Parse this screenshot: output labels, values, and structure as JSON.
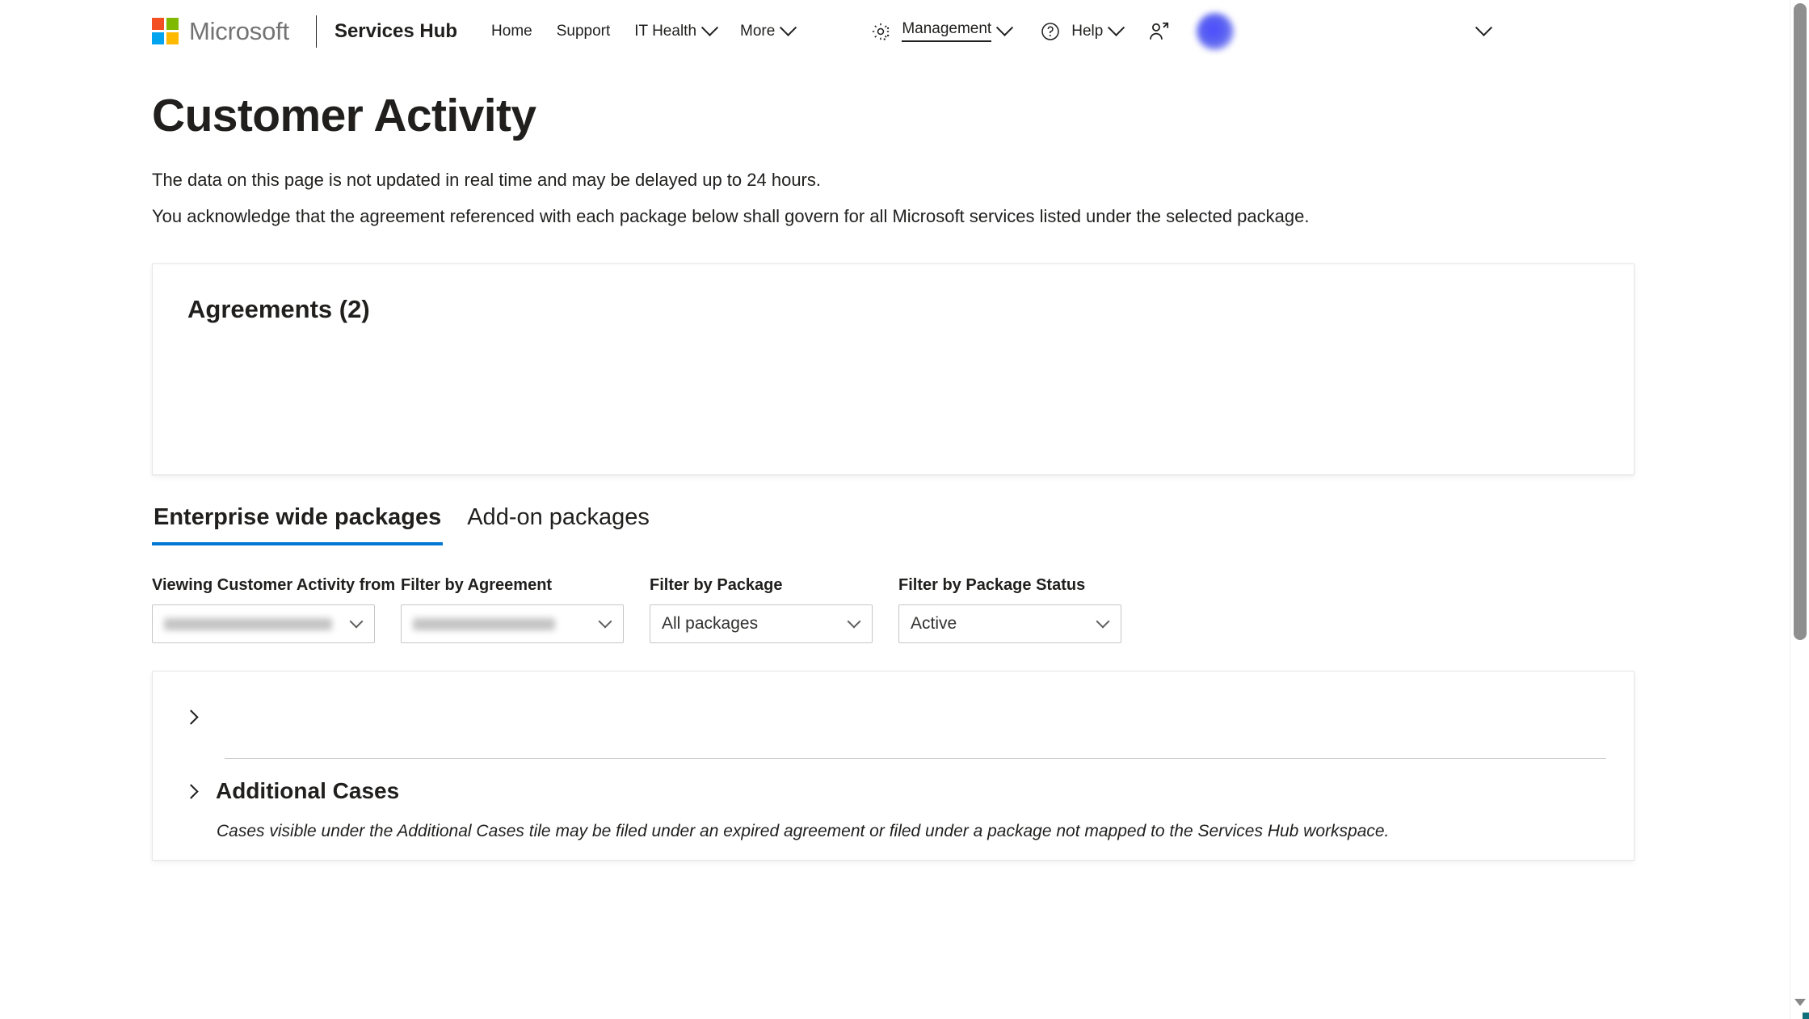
{
  "header": {
    "brand": "Microsoft",
    "product": "Services Hub",
    "logo_colors": {
      "red": "#F25022",
      "green": "#7FBA00",
      "blue": "#00A4EF",
      "yellow": "#FFB900"
    },
    "nav": [
      {
        "label": "Home",
        "has_chevron": false,
        "active": false
      },
      {
        "label": "Support",
        "has_chevron": false,
        "active": false
      },
      {
        "label": "IT Health",
        "has_chevron": true,
        "active": false
      },
      {
        "label": "More",
        "has_chevron": true,
        "active": false
      }
    ],
    "right_nav": [
      {
        "label": "Management",
        "icon": "gear-icon",
        "has_chevron": true,
        "active": true
      },
      {
        "label": "Help",
        "icon": "question-circle-icon",
        "has_chevron": true,
        "active": false
      }
    ],
    "invite_icon": "person-add-icon",
    "account": {
      "name_redacted": true,
      "chevron": "chevron-down-icon"
    }
  },
  "main": {
    "title": "Customer Activity",
    "lede": [
      "The data on this page is not updated in real time and may be delayed up to 24 hours.",
      "You acknowledge that the agreement referenced with each package below shall govern for all Microsoft services listed under the selected package."
    ]
  },
  "agreements": {
    "title": "Agreements (2)",
    "count": 2,
    "items": [
      {
        "name_redacted": true
      },
      {
        "name_redacted": true
      }
    ]
  },
  "tabs": [
    {
      "label": "Enterprise wide packages",
      "active": true
    },
    {
      "label": "Add-on packages",
      "active": false
    }
  ],
  "filters": [
    {
      "label": "Viewing Customer Activity from",
      "value": "",
      "redacted": true,
      "caret": "chevron-down-icon"
    },
    {
      "label": "Filter by Agreement",
      "value": "",
      "redacted": true,
      "caret": "chevron-down-icon"
    },
    {
      "label": "Filter by Package",
      "value": "All packages",
      "redacted": false,
      "caret": "chevron-down-icon"
    },
    {
      "label": "Filter by Package Status",
      "value": "Active",
      "redacted": false,
      "caret": "chevron-down-icon"
    }
  ],
  "packages": {
    "rows": [
      {
        "title_redacted": true,
        "meta_redacted": true,
        "expander": "chevron-right-icon"
      }
    ],
    "additional_cases": {
      "title": "Additional Cases",
      "expander": "chevron-right-icon",
      "note": "Cases visible under the Additional Cases tile may be filed under an expired agreement or filed under a package not mapped to the Services Hub workspace."
    }
  },
  "colors": {
    "accent": "#0078d4",
    "text": "#201f1e",
    "border": "#c8c6c4",
    "card_border": "#e6e6e6",
    "scrollbar_thumb": "#8f8f8f"
  },
  "scrollbar": {
    "orientation": "vertical",
    "down_arrow_icon": "caret-down-icon"
  }
}
